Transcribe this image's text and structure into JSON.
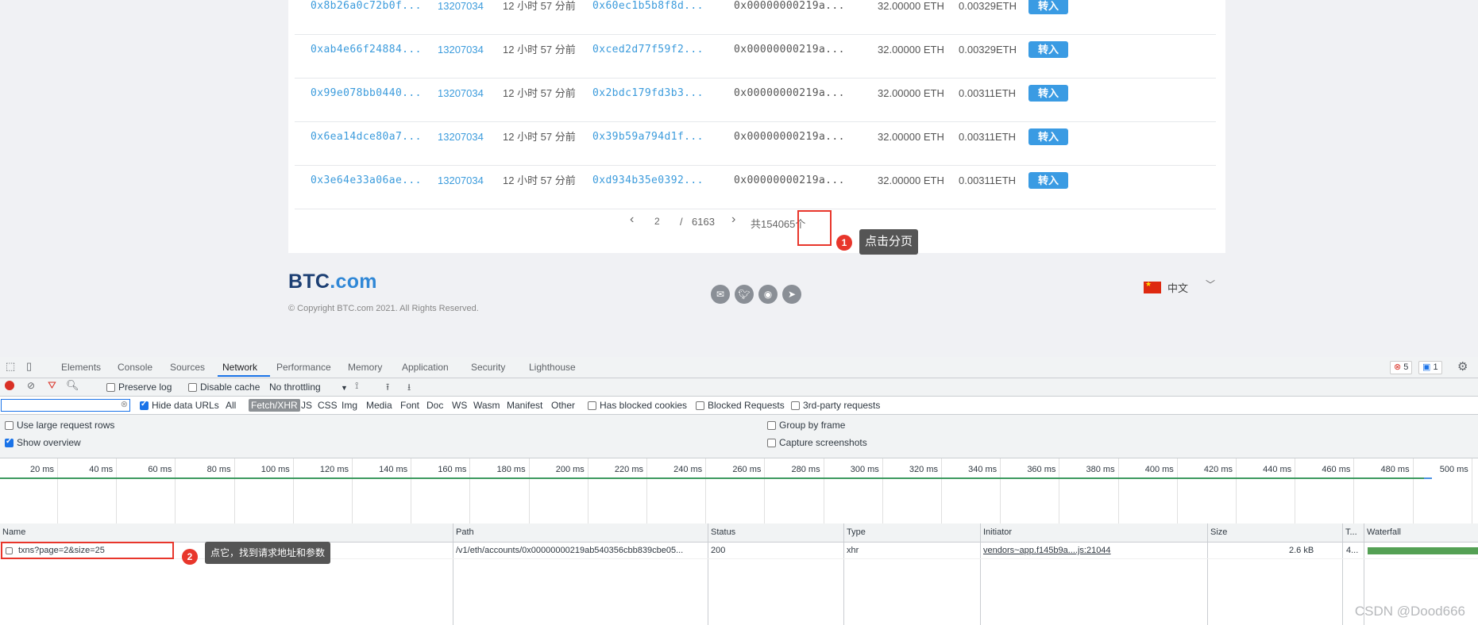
{
  "transactions": [
    {
      "hash": "0x8b26a0c72b0f...",
      "block": "13207034",
      "age": "12 小时 57 分前",
      "from": "0x60ec1b5b8f8d...",
      "to": "0x00000000219a...",
      "amount": "32.00000 ETH",
      "fee": "0.00329ETH",
      "dir": "转入"
    },
    {
      "hash": "0xab4e66f24884...",
      "block": "13207034",
      "age": "12 小时 57 分前",
      "from": "0xced2d77f59f2...",
      "to": "0x00000000219a...",
      "amount": "32.00000 ETH",
      "fee": "0.00329ETH",
      "dir": "转入"
    },
    {
      "hash": "0x99e078bb0440...",
      "block": "13207034",
      "age": "12 小时 57 分前",
      "from": "0x2bdc179fd3b3...",
      "to": "0x00000000219a...",
      "amount": "32.00000 ETH",
      "fee": "0.00311ETH",
      "dir": "转入"
    },
    {
      "hash": "0x6ea14dce80a7...",
      "block": "13207034",
      "age": "12 小时 57 分前",
      "from": "0x39b59a794d1f...",
      "to": "0x00000000219a...",
      "amount": "32.00000 ETH",
      "fee": "0.00311ETH",
      "dir": "转入"
    },
    {
      "hash": "0x3e64e33a06ae...",
      "block": "13207034",
      "age": "12 小时 57 分前",
      "from": "0xd934b35e0392...",
      "to": "0x00000000219a...",
      "amount": "32.00000 ETH",
      "fee": "0.00311ETH",
      "dir": "转入"
    }
  ],
  "pager": {
    "prev": "‹",
    "page": "2",
    "sep": "/",
    "total_pages": "6163",
    "next": "›",
    "total": "共154065个"
  },
  "annotations": {
    "step1": "1",
    "tip1": "点击分页",
    "step2": "2",
    "tip2": "点它，找到请求地址和参数"
  },
  "footer": {
    "logo_a": "BTC",
    "logo_b": ".com",
    "copyright": "© Copyright BTC.com 2021. All Rights Reserved.",
    "language": "中文",
    "social_icons": [
      "mail-icon",
      "twitter-icon",
      "weibo-icon",
      "telegram-icon"
    ]
  },
  "devtools": {
    "tabs": [
      "Elements",
      "Console",
      "Sources",
      "Network",
      "Performance",
      "Memory",
      "Application",
      "Security",
      "Lighthouse"
    ],
    "active_tab": "Network",
    "errors": "5",
    "messages": "1",
    "toolbar": {
      "preserve_log": "Preserve log",
      "disable_cache": "Disable cache",
      "throttling": "No throttling"
    },
    "filter": {
      "hide_data_urls": "Hide data URLs",
      "all": "All",
      "types": [
        "Fetch/XHR",
        "JS",
        "CSS",
        "Img",
        "Media",
        "Font",
        "Doc",
        "WS",
        "Wasm",
        "Manifest",
        "Other"
      ],
      "has_blocked_cookies": "Has blocked cookies",
      "blocked_requests": "Blocked Requests",
      "third_party": "3rd-party requests"
    },
    "options": {
      "large_rows": "Use large request rows",
      "show_overview": "Show overview",
      "group_by_frame": "Group by frame",
      "capture_screenshots": "Capture screenshots"
    },
    "ticks": [
      "20 ms",
      "40 ms",
      "60 ms",
      "80 ms",
      "100 ms",
      "120 ms",
      "140 ms",
      "160 ms",
      "180 ms",
      "200 ms",
      "220 ms",
      "240 ms",
      "260 ms",
      "280 ms",
      "300 ms",
      "320 ms",
      "340 ms",
      "360 ms",
      "380 ms",
      "400 ms",
      "420 ms",
      "440 ms",
      "460 ms",
      "480 ms",
      "500 ms"
    ],
    "columns": {
      "name": "Name",
      "path": "Path",
      "status": "Status",
      "type": "Type",
      "initiator": "Initiator",
      "size": "Size",
      "time": "T...",
      "waterfall": "Waterfall"
    },
    "request": {
      "name": "txns?page=2&size=25",
      "path": "/v1/eth/accounts/0x00000000219ab540356cbb839cbe05...",
      "status": "200",
      "type": "xhr",
      "initiator": "vendors~app.f145b9a....js:21044",
      "size": "2.6 kB",
      "time": "4..."
    }
  },
  "watermark": "CSDN @Dood666",
  "colors": {
    "link": "#3b9bdc",
    "badge": "#3a9be3",
    "highlight": "#e8362b",
    "devtools_accent": "#1a73e8"
  }
}
